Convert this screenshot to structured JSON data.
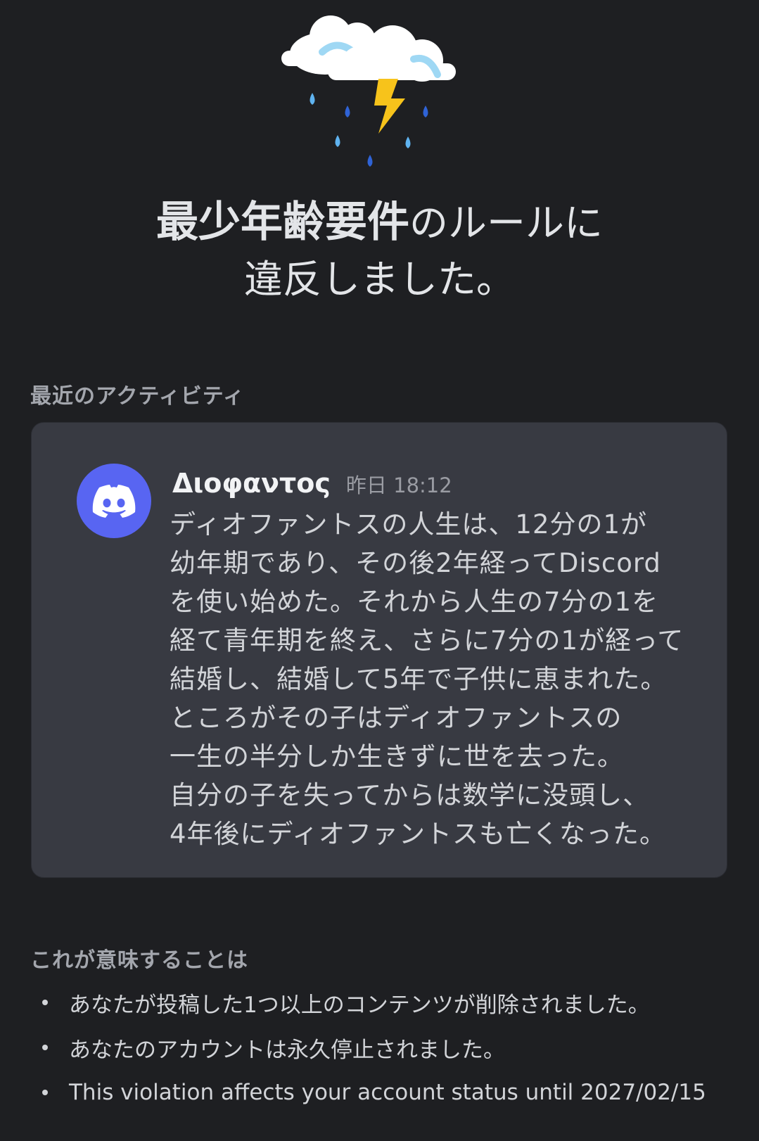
{
  "hero": {
    "icon": "storm-cloud-icon"
  },
  "title": {
    "emphasis": "最少年齢要件",
    "line1_rest": "のルールに",
    "line2": "違反しました。"
  },
  "activity": {
    "section_label": "最近のアクティビティ",
    "message": {
      "avatar_icon": "discord-logo-icon",
      "username": "Διοφαντος",
      "timestamp": "昨日 18:12",
      "lines": [
        "ディオファントスの人生は、12分の1が",
        "幼年期であり、その後2年経ってDiscord",
        "を使い始めた。それから人生の7分の1を",
        "経て青年期を終え、さらに7分の1が経って",
        "結婚し、結婚して5年で子供に恵まれた。",
        "ところがその子はディオファントスの",
        "一生の半分しか生きずに世を去った。",
        "自分の子を失ってからは数学に没頭し、",
        "4年後にディオファントスも亡くなった。"
      ]
    }
  },
  "meaning": {
    "section_label": "これが意味することは",
    "items": [
      "あなたが投稿した1つ以上のコンテンツが削除されました。",
      "あなたのアカウントは永久停止されました。",
      "This violation affects your account status until 2027/02/15"
    ]
  },
  "colors": {
    "background": "#1e1f22",
    "card": "#383a42",
    "discord_blurple": "#5865f2",
    "muted_text": "#a3a6ad"
  }
}
